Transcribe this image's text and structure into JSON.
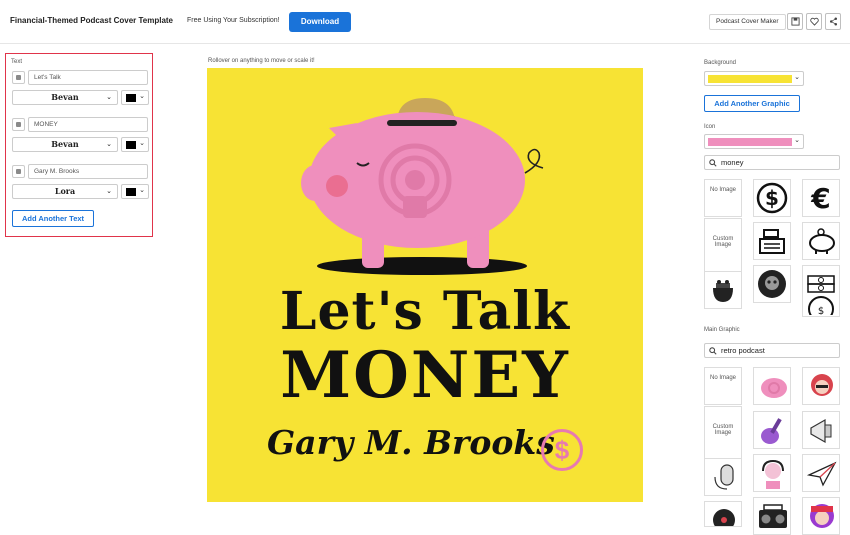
{
  "header": {
    "title": "Financial-Themed Podcast Cover Template",
    "subscription": "Free Using Your Subscription!",
    "download_label": "Download",
    "maker_label": "Podcast Cover Maker",
    "icons": [
      "save-icon",
      "heart-icon",
      "share-icon"
    ]
  },
  "text_panel": {
    "section_label": "Text",
    "items": [
      {
        "value": "Let's Talk",
        "font": "Bevan",
        "color": "#000000",
        "checked": true
      },
      {
        "value": "MONEY",
        "font": "Bevan",
        "color": "#000000",
        "checked": true
      },
      {
        "value": "Gary M. Brooks",
        "font": "Lora",
        "color": "#000000",
        "checked": true
      }
    ],
    "add_label": "Add Another Text"
  },
  "canvas": {
    "hint": "Rollover on anything to move or scale it!",
    "background_color": "#f7e334",
    "line1": "Let's Talk",
    "line2": "MONEY",
    "line3": "Gary M. Brooks",
    "coin_symbol": "$"
  },
  "right_panel": {
    "background_label": "Background",
    "background_color": "#f7e334",
    "add_graphic_label": "Add Another Graphic",
    "icon_label": "Icon",
    "icon_color": "#ef8fbd",
    "icon_search": "money",
    "no_image_label": "No Image",
    "custom_image_label": "Custom Image",
    "main_graphic_label": "Main Graphic",
    "main_search": "retro podcast"
  },
  "colors": {
    "accent": "#1a73d9",
    "highlight_border": "#e0344a",
    "pig_pink": "#ef8fbd"
  }
}
